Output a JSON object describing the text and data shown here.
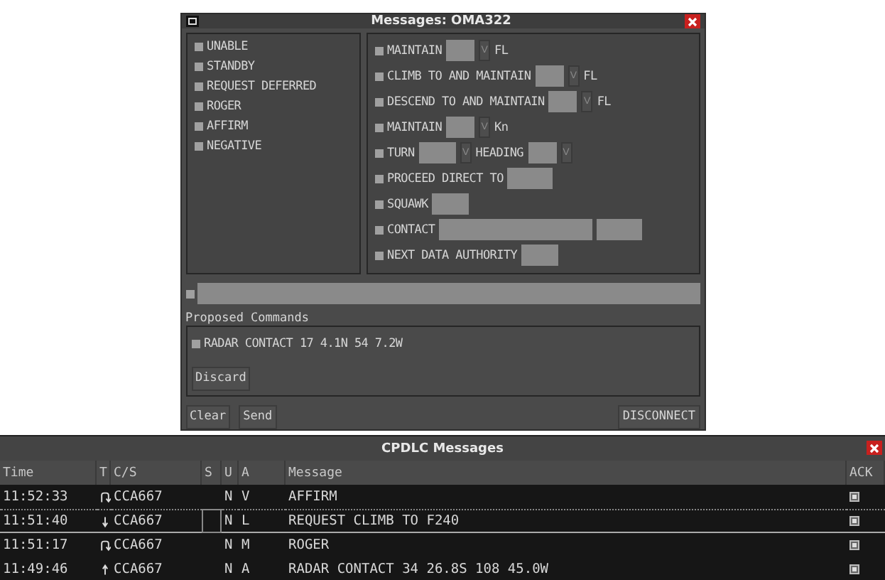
{
  "messages_window": {
    "title": "Messages: OMA322",
    "responses": [
      {
        "label": "UNABLE",
        "checked": false
      },
      {
        "label": "STANDBY",
        "checked": false
      },
      {
        "label": "REQUEST DEFERRED",
        "checked": false
      },
      {
        "label": "ROGER",
        "checked": false
      },
      {
        "label": "AFFIRM",
        "checked": false
      },
      {
        "label": "NEGATIVE",
        "checked": false
      }
    ],
    "commands": [
      {
        "checked": false,
        "parts": [
          {
            "kind": "text",
            "text": "MAINTAIN"
          },
          {
            "kind": "short"
          },
          {
            "kind": "select",
            "text": "V"
          },
          {
            "kind": "text",
            "text": "FL"
          }
        ]
      },
      {
        "checked": false,
        "parts": [
          {
            "kind": "text",
            "text": "CLIMB TO AND MAINTAIN"
          },
          {
            "kind": "short"
          },
          {
            "kind": "select",
            "text": "V"
          },
          {
            "kind": "text",
            "text": "FL"
          }
        ]
      },
      {
        "checked": false,
        "parts": [
          {
            "kind": "text",
            "text": "DESCEND TO AND MAINTAIN"
          },
          {
            "kind": "short"
          },
          {
            "kind": "select",
            "text": "V"
          },
          {
            "kind": "text",
            "text": "FL"
          }
        ]
      },
      {
        "checked": false,
        "parts": [
          {
            "kind": "text",
            "text": "MAINTAIN"
          },
          {
            "kind": "short"
          },
          {
            "kind": "select",
            "text": "V"
          },
          {
            "kind": "text",
            "text": "Kn"
          }
        ]
      },
      {
        "checked": false,
        "parts": [
          {
            "kind": "text",
            "text": "TURN"
          },
          {
            "kind": "medium"
          },
          {
            "kind": "select",
            "text": "V"
          },
          {
            "kind": "text",
            "text": "HEADING"
          },
          {
            "kind": "short"
          },
          {
            "kind": "select",
            "text": "V"
          }
        ]
      },
      {
        "checked": false,
        "parts": [
          {
            "kind": "text",
            "text": "PROCEED DIRECT TO"
          },
          {
            "kind": "long"
          }
        ]
      },
      {
        "checked": false,
        "parts": [
          {
            "kind": "text",
            "text": "SQUAWK"
          },
          {
            "kind": "medium"
          }
        ]
      },
      {
        "checked": false,
        "parts": [
          {
            "kind": "text",
            "text": "CONTACT"
          },
          {
            "kind": "wide"
          },
          {
            "kind": "long"
          }
        ]
      },
      {
        "checked": false,
        "parts": [
          {
            "kind": "text",
            "text": "NEXT DATA AUTHORITY"
          },
          {
            "kind": "medium"
          }
        ]
      }
    ],
    "free_text": {
      "checked": false
    },
    "proposed": {
      "legend": "Proposed Commands",
      "items": [
        {
          "text": "RADAR CONTACT 17 4.1N 54 7.2W",
          "checked": false
        }
      ],
      "discard": "Discard"
    },
    "buttons": {
      "clear": "Clear",
      "send": "Send",
      "disconnect": "DISCONNECT"
    }
  },
  "cpdlc_window": {
    "title": "CPDLC Messages",
    "columns": [
      "Time",
      "T",
      "C/S",
      "S",
      "U",
      "A",
      "Message",
      "ACK"
    ],
    "rows": [
      {
        "time": "11:52:33",
        "kind": "reply",
        "acked": false,
        "callsign": "CCA667",
        "u": "N",
        "a": "V",
        "message": "AFFIRM",
        "selected": false
      },
      {
        "time": "11:51:40",
        "kind": "down",
        "acked": false,
        "callsign": "CCA667",
        "u": "N",
        "a": "L",
        "message": "REQUEST CLIMB TO F240",
        "selected": true
      },
      {
        "time": "11:51:17",
        "kind": "reply",
        "acked": false,
        "callsign": "CCA667",
        "u": "N",
        "a": "M",
        "message": "ROGER",
        "selected": false
      },
      {
        "time": "11:49:46",
        "kind": "up",
        "acked": false,
        "callsign": "CCA667",
        "u": "N",
        "a": "A",
        "message": "RADAR CONTACT 34 26.8S 108 45.0W",
        "selected": false
      }
    ]
  }
}
